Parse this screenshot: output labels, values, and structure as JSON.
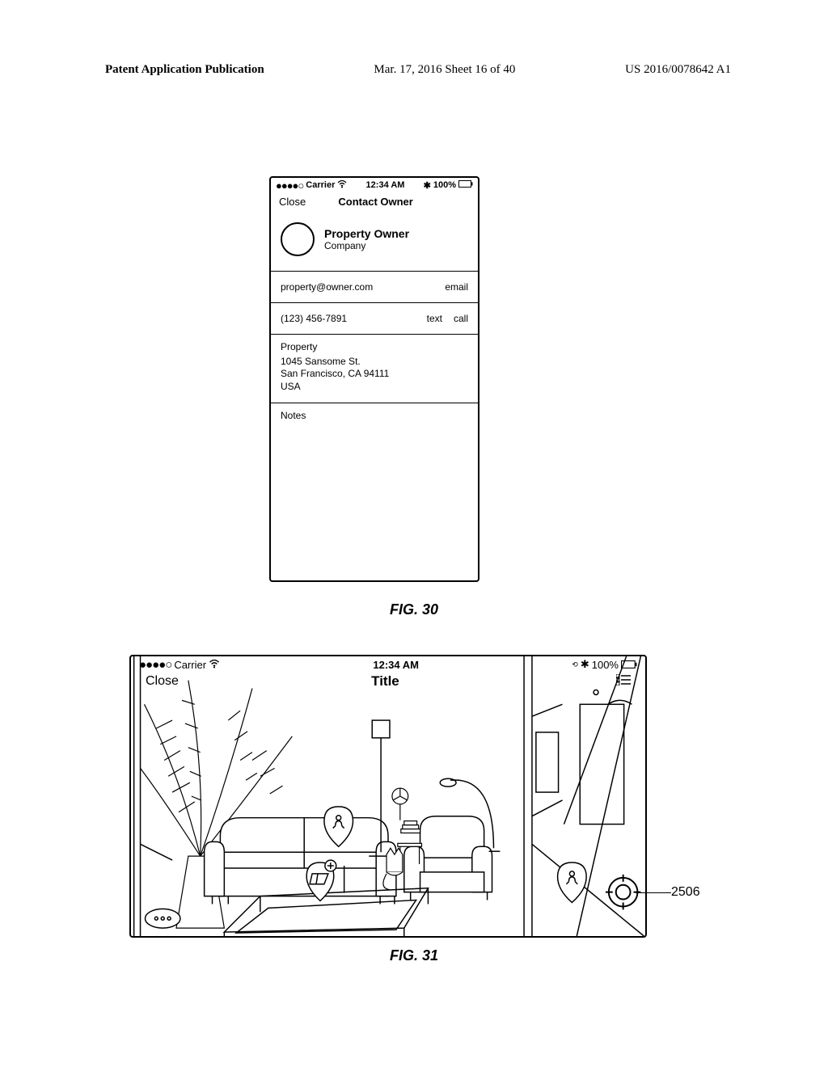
{
  "header": {
    "left": "Patent Application Publication",
    "mid": "Mar. 17, 2016  Sheet 16 of 40",
    "right": "US 2016/0078642 A1"
  },
  "fig30": {
    "status": {
      "dots": "●●●●○",
      "carrier": "Carrier",
      "time": "12:34 AM",
      "bt": "✱",
      "battery_pct": "100%"
    },
    "nav": {
      "close": "Close",
      "title": "Contact Owner"
    },
    "owner": {
      "name": "Property Owner",
      "company": "Company"
    },
    "email_row": {
      "value": "property@owner.com",
      "action": "email"
    },
    "phone_row": {
      "value": "(123) 456-7891",
      "action_text": "text",
      "action_call": "call"
    },
    "address": {
      "label": "Property",
      "line1": "1045 Sansome St.",
      "line2": "San Francisco, CA 94111",
      "line3": "USA"
    },
    "notes_label": "Notes",
    "caption": "FIG. 30"
  },
  "fig31": {
    "status": {
      "dots": "●●●●○",
      "carrier": "Carrier",
      "time": "12:34 AM",
      "bt": "✱",
      "battery_pct": "100%"
    },
    "nav": {
      "close": "Close",
      "title": "Title"
    },
    "ref_num": "2506",
    "caption": "FIG. 31"
  }
}
